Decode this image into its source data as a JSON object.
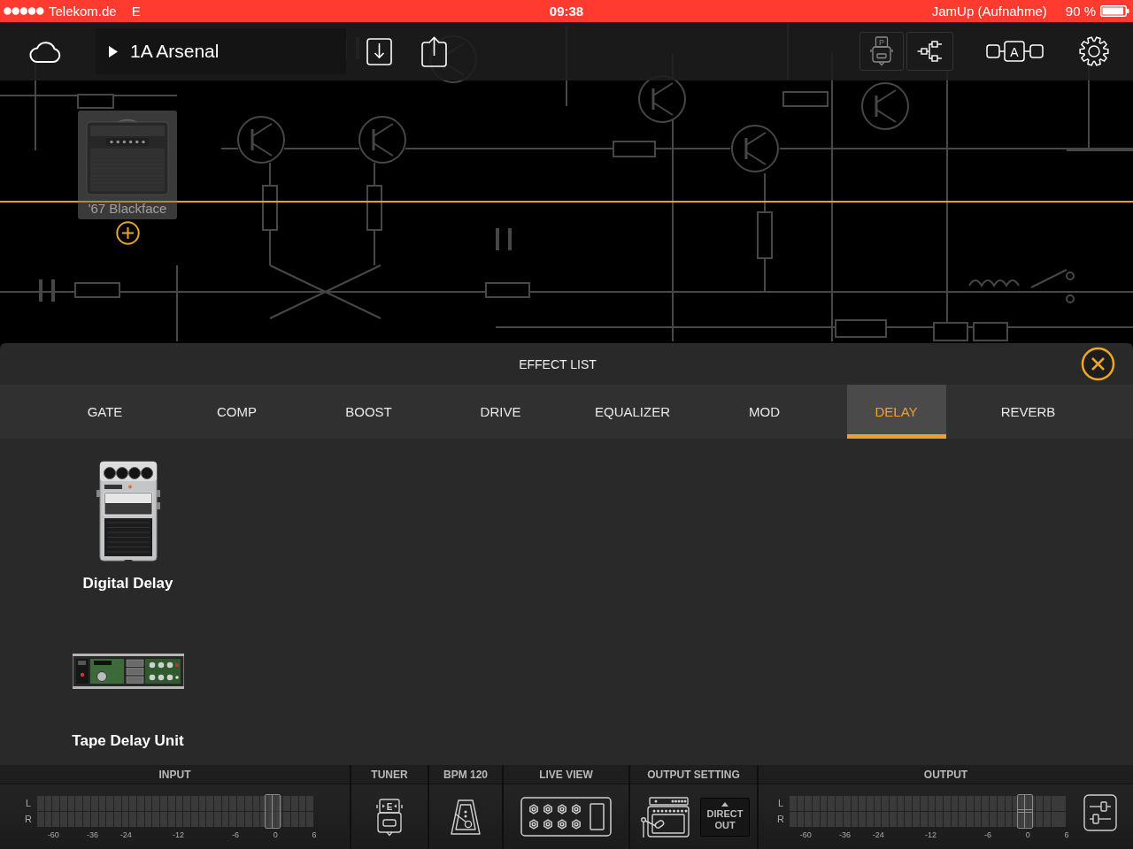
{
  "status_bar": {
    "carrier": "Telekom.de",
    "network": "E",
    "time": "09:38",
    "app": "JamUp (Aufnahme)",
    "battery": "90 %"
  },
  "toolbar": {
    "preset": "1A Arsenal",
    "pedal_mode": {
      "label": "P",
      "selected": false
    },
    "split_mode": {
      "selected": true
    },
    "chain_label": "A"
  },
  "canvas": {
    "amp": {
      "name": "'67 Blackface"
    }
  },
  "effect_list": {
    "title": "EFFECT LIST",
    "tabs": [
      {
        "label": "GATE",
        "selected": false
      },
      {
        "label": "COMP",
        "selected": false
      },
      {
        "label": "BOOST",
        "selected": false
      },
      {
        "label": "DRIVE",
        "selected": false
      },
      {
        "label": "EQUALIZER",
        "selected": false
      },
      {
        "label": "MOD",
        "selected": false
      },
      {
        "label": "DELAY",
        "selected": true
      },
      {
        "label": "REVERB",
        "selected": false
      }
    ],
    "effects": [
      {
        "name": "Digital Delay",
        "kind": "pedal"
      },
      {
        "name": "Tape Delay Unit",
        "kind": "rack"
      }
    ]
  },
  "bottom_bar": {
    "input": {
      "title": "INPUT",
      "channels": [
        "L",
        "R"
      ],
      "scale": [
        "-60",
        "-36",
        "-24",
        "-12",
        "-6",
        "0",
        "6"
      ],
      "level": 0.85
    },
    "tuner": {
      "title": "TUNER",
      "note": "E"
    },
    "bpm": {
      "title": "BPM 120"
    },
    "live_view": {
      "title": "LIVE VIEW"
    },
    "output_setting": {
      "title": "OUTPUT SETTING",
      "button": "DIRECT OUT"
    },
    "output": {
      "title": "OUTPUT",
      "channels": [
        "L",
        "R"
      ],
      "scale": [
        "-60",
        "-36",
        "-24",
        "-12",
        "-6",
        "0",
        "6"
      ],
      "level": 0.85
    }
  }
}
